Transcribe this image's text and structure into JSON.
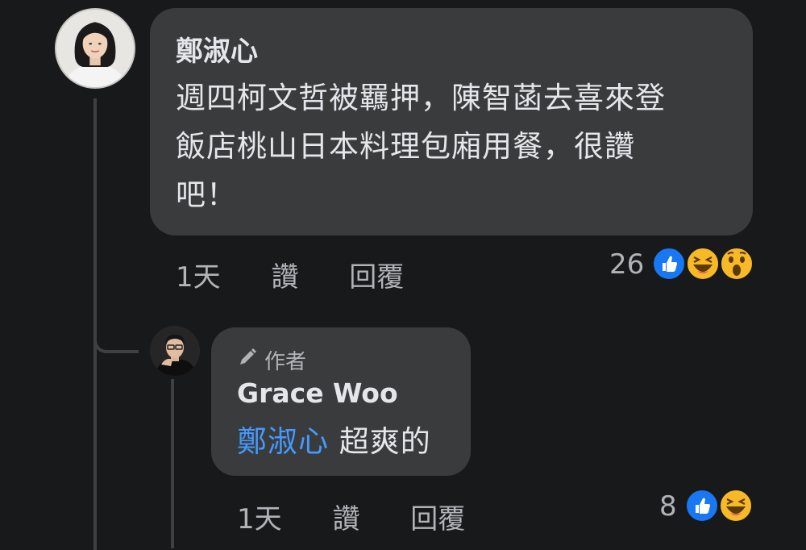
{
  "comment": {
    "author": "鄭淑心",
    "text_lines": [
      "週四柯文哲被羈押，陳智菡去喜來登",
      "飯店桃山日本料理包廂用餐，很讚",
      "吧！"
    ],
    "time": "1天",
    "like_label": "讚",
    "reply_label": "回覆",
    "reaction_count": "26",
    "reactions": [
      "like-icon",
      "haha-icon",
      "wow-icon"
    ]
  },
  "reply": {
    "badge": "作者",
    "badge_icon": "pencil-icon",
    "author": "Grace Woo",
    "mention": "鄭淑心",
    "text": " 超爽的",
    "time": "1天",
    "like_label": "讚",
    "reply_label": "回覆",
    "reaction_count": "8",
    "reactions": [
      "like-icon",
      "haha-icon"
    ]
  },
  "colors": {
    "background": "#18191a",
    "bubble": "#3a3b3c",
    "mention": "#4599ff",
    "like": "#1877f2",
    "emoji_yellow": "#f7b928"
  }
}
